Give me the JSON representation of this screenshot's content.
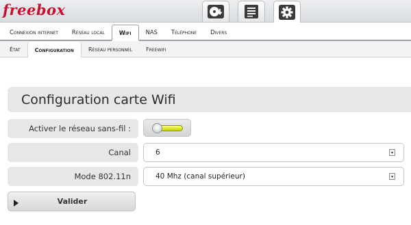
{
  "brand": {
    "logo_text": "freebox",
    "color": "#c8102e"
  },
  "top_nav": [
    {
      "name": "disk-download-icon",
      "active": false
    },
    {
      "name": "document-list-icon",
      "active": false
    },
    {
      "name": "gear-icon",
      "active": true
    }
  ],
  "tabs": [
    {
      "label": "Connexion internet",
      "active": false
    },
    {
      "label": "Réseau local",
      "active": false
    },
    {
      "label": "Wifi",
      "active": true
    },
    {
      "label": "NAS",
      "active": false
    },
    {
      "label": "Téléphone",
      "active": false
    },
    {
      "label": "Divers",
      "active": false
    }
  ],
  "subtabs": [
    {
      "label": "État",
      "active": false
    },
    {
      "label": "Configuration",
      "active": true
    },
    {
      "label": "Réseau personnel",
      "active": false
    },
    {
      "label": "Freewifi",
      "active": false
    }
  ],
  "page": {
    "title": "Configuration carte Wifi"
  },
  "form": {
    "wifi_enabled": {
      "label": "Activer le réseau sans-fil :",
      "value": true
    },
    "channel": {
      "label": "Canal",
      "value": "6"
    },
    "mode": {
      "label": "Mode 802.11n",
      "value": "40 Mhz (canal supérieur)"
    },
    "submit_label": "Valider"
  }
}
